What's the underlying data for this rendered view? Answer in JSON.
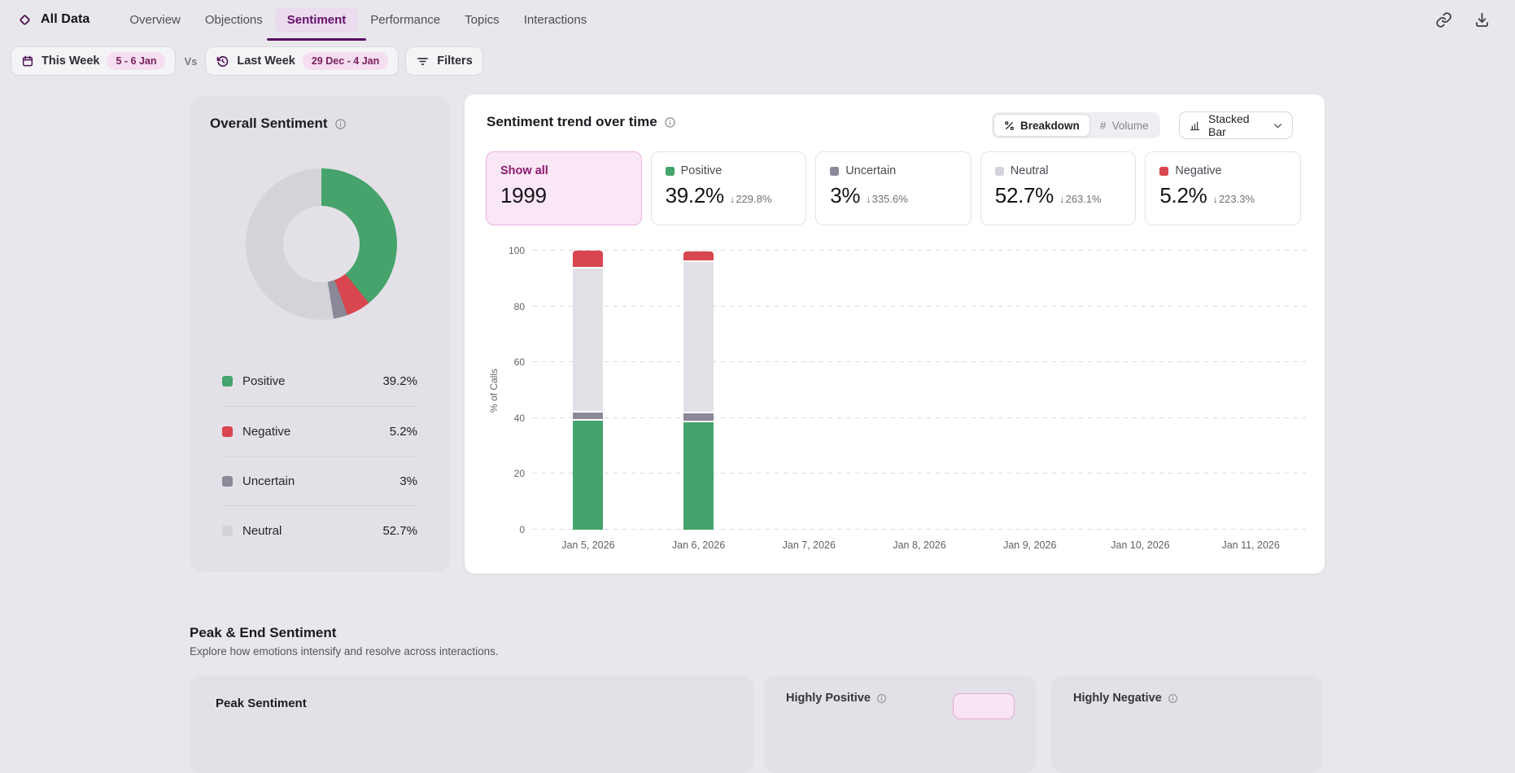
{
  "nav": {
    "brand": "All Data",
    "tabs": [
      {
        "label": "Overview",
        "active": false
      },
      {
        "label": "Objections",
        "active": false
      },
      {
        "label": "Sentiment",
        "active": true
      },
      {
        "label": "Performance",
        "active": false
      },
      {
        "label": "Topics",
        "active": false
      },
      {
        "label": "Interactions",
        "active": false
      }
    ],
    "action_icons": [
      "link-icon",
      "download-icon"
    ]
  },
  "filters": {
    "primary": {
      "label": "This Week",
      "badge": "5 - 6 Jan",
      "icon": "calendar-icon"
    },
    "vs_label": "Vs",
    "compare": {
      "label": "Last Week",
      "badge": "29 Dec - 4 Jan",
      "icon": "history-icon"
    },
    "filters_label": "Filters"
  },
  "overall_sentiment": {
    "title": "Overall Sentiment",
    "legend": [
      {
        "label": "Positive",
        "value": "39.2%",
        "pct": 39.2,
        "color": "#45a36b"
      },
      {
        "label": "Negative",
        "value": "5.2%",
        "pct": 5.2,
        "color": "#d8464f"
      },
      {
        "label": "Uncertain",
        "value": "3%",
        "pct": 3.0,
        "color": "#8b8997"
      },
      {
        "label": "Neutral",
        "value": "52.7%",
        "pct": 52.7,
        "color": "#d5d3d9"
      }
    ]
  },
  "trend": {
    "title": "Sentiment trend over time",
    "view_toggle": [
      {
        "label": "Breakdown",
        "icon": "percent-icon",
        "active": true
      },
      {
        "label": "Volume",
        "icon": "hash-icon",
        "active": false
      }
    ],
    "chart_type": "Stacked Bar",
    "stats": [
      {
        "label": "Show all",
        "value": "1999",
        "highlight": true
      },
      {
        "label": "Positive",
        "value": "39.2%",
        "delta": "229.8%",
        "color": "#45a36b"
      },
      {
        "label": "Uncertain",
        "value": "3%",
        "delta": "335.6%",
        "color": "#8b8997"
      },
      {
        "label": "Neutral",
        "value": "52.7%",
        "delta": "263.1%",
        "color": "#d5d3d9"
      },
      {
        "label": "Negative",
        "value": "5.2%",
        "delta": "223.3%",
        "color": "#d8464f"
      }
    ]
  },
  "chart_data": {
    "type": "bar",
    "stacked": true,
    "title": "Sentiment trend over time",
    "ylabel": "% of Calls",
    "ylim": [
      0,
      100
    ],
    "yticks": [
      0,
      20,
      40,
      60,
      80,
      100
    ],
    "grid": "dashed-horizontal",
    "categories": [
      "Jan 5, 2026",
      "Jan 6, 2026",
      "Jan 7, 2026",
      "Jan 8, 2026",
      "Jan 9, 2026",
      "Jan 10, 2026",
      "Jan 11, 2026"
    ],
    "series": [
      {
        "name": "Positive",
        "color": "#45a36b",
        "values": [
          39.0,
          38.5,
          0,
          0,
          0,
          0,
          0
        ]
      },
      {
        "name": "Uncertain",
        "color": "#8b8997",
        "values": [
          2.9,
          3.3,
          0,
          0,
          0,
          0,
          0
        ]
      },
      {
        "name": "Neutral",
        "color": "#e2e0e6",
        "values": [
          51.6,
          54.1,
          0,
          0,
          0,
          0,
          0
        ]
      },
      {
        "name": "Negative",
        "color": "#d8464f",
        "values": [
          6.5,
          3.9,
          0,
          0,
          0,
          0,
          0
        ]
      }
    ]
  },
  "peak_end": {
    "title": "Peak & End Sentiment",
    "subtitle": "Explore how emotions intensify and resolve across interactions.",
    "cards": [
      {
        "label": "Peak Sentiment"
      },
      {
        "label": "Highly Positive"
      },
      {
        "label": "Highly Negative"
      }
    ]
  }
}
